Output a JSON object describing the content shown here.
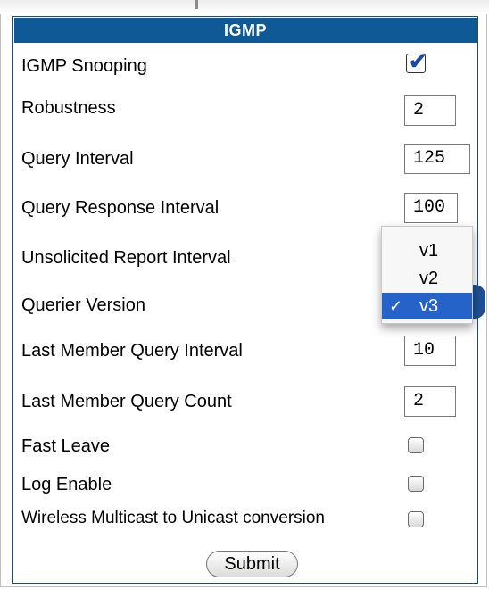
{
  "title": "IGMP",
  "rows": {
    "igmp_snooping": {
      "label": "IGMP Snooping",
      "checked": true
    },
    "robustness": {
      "label": "Robustness",
      "value": "2"
    },
    "query_interval": {
      "label": "Query Interval",
      "value": "125"
    },
    "query_response_interval": {
      "label": "Query Response Interval",
      "value": "100"
    },
    "unsolicited_report_interval": {
      "label": "Unsolicited Report Interval"
    },
    "querier_version": {
      "label": "Querier Version",
      "options": [
        "v1",
        "v2",
        "v3"
      ],
      "selected": "v3",
      "check_symbol": "✓"
    },
    "last_member_query_interval": {
      "label": "Last Member Query Interval",
      "value": "10"
    },
    "last_member_query_count": {
      "label": "Last Member Query Count",
      "value": "2"
    },
    "fast_leave": {
      "label": "Fast Leave",
      "checked": false
    },
    "log_enable": {
      "label": "Log Enable",
      "checked": false
    },
    "wireless_multicast_to_unicast": {
      "label": "Wireless Multicast to Unicast conversion",
      "checked": false
    }
  },
  "submit_label": "Submit",
  "checkbox_checked_symbol": "✔"
}
